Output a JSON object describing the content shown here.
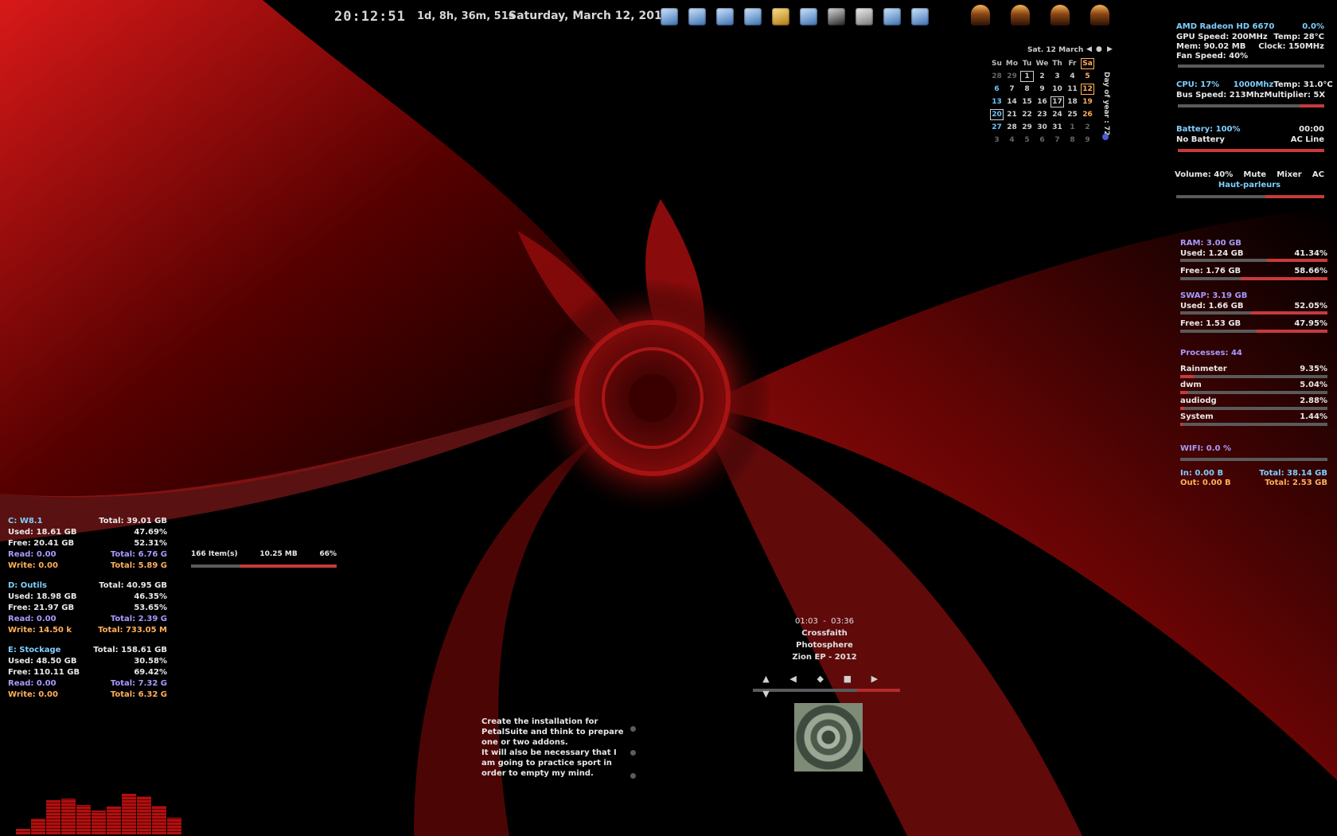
{
  "topbar": {
    "clock": "20:12:51",
    "uptime": "1d, 8h, 36m, 51s",
    "date": "Saturday, March 12, 2016",
    "dock_icons": [
      "calculator-icon",
      "paint-icon",
      "network-icon",
      "monitor-icon",
      "folder-icon",
      "task-manager-icon",
      "terminal-icon",
      "printer-icon",
      "documents-icon",
      "settings-icon"
    ],
    "lamps": [
      "lamp-1-icon",
      "lamp-2-icon",
      "lamp-3-icon",
      "lamp-4-icon"
    ]
  },
  "calendar": {
    "header": "Sat. 12 March",
    "day_names": [
      "Su",
      "Mo",
      "Tu",
      "We",
      "Th",
      "Fr",
      "Sa"
    ],
    "weeks": [
      [
        "28",
        "29",
        "1",
        "2",
        "3",
        "4",
        "5"
      ],
      [
        "6",
        "7",
        "8",
        "9",
        "10",
        "11",
        "12"
      ],
      [
        "13",
        "14",
        "15",
        "16",
        "17",
        "18",
        "19"
      ],
      [
        "20",
        "21",
        "22",
        "23",
        "24",
        "25",
        "26"
      ],
      [
        "27",
        "28",
        "29",
        "30",
        "31",
        "1",
        "2"
      ],
      [
        "3",
        "4",
        "5",
        "6",
        "7",
        "8",
        "9"
      ]
    ],
    "day_of_year": "Day of year : 72"
  },
  "gpu": {
    "name": "AMD Radeon HD 6670",
    "load": "0.0%",
    "speed": "GPU Speed: 200MHz",
    "temp": "Temp: 28°C",
    "mem": "Mem: 90.02 MB",
    "clock": "Clock: 150MHz",
    "fan": "Fan Speed: 40%",
    "bar": 0.0
  },
  "cpu": {
    "usage": "CPU: 17%",
    "freq": "1000Mhz",
    "temp": "Temp: 31.0°C",
    "bus": "Bus Speed: 213Mhz",
    "mult": "Multiplier: 5X",
    "bar": 0.17
  },
  "battery": {
    "level": "Battery: 100%",
    "time": "00:00",
    "status": "No Battery",
    "source": "AC Line",
    "bar": 1.0
  },
  "volume": {
    "level": "Volume: 40%",
    "mute": "Mute",
    "mixer": "Mixer",
    "ac": "AC",
    "device": "Haut-parleurs",
    "bar": 0.4
  },
  "ram": {
    "title": "RAM: 3.00 GB",
    "used": "Used: 1.24 GB",
    "used_pct": "41.34%",
    "free": "Free: 1.76 GB",
    "free_pct": "58.66%",
    "used_bar": 0.4134,
    "free_bar": 0.5866
  },
  "swap": {
    "title": "SWAP: 3.19 GB",
    "used": "Used: 1.66 GB",
    "used_pct": "52.05%",
    "free": "Free: 1.53 GB",
    "free_pct": "47.95%",
    "used_bar": 0.5205,
    "free_bar": 0.4795
  },
  "processes": {
    "title": "Processes: 44",
    "items": [
      {
        "name": "Rainmeter",
        "pct": "9.35%",
        "bar": 0.0935
      },
      {
        "name": "dwm",
        "pct": "5.04%",
        "bar": 0.0504
      },
      {
        "name": "audiodg",
        "pct": "2.88%",
        "bar": 0.0288
      },
      {
        "name": "System",
        "pct": "1.44%",
        "bar": 0.0144
      }
    ]
  },
  "wifi": {
    "title": "WIFI: 0.0 %",
    "in": "In: 0.00 B",
    "in_total": "Total: 38.14 GB",
    "out": "Out: 0.00 B",
    "out_total": "Total: 2.53 GB",
    "bar": 0.0
  },
  "drives": [
    {
      "name": "C: W8.1",
      "total": "Total: 39.01 GB",
      "used": "Used: 18.61 GB",
      "used_pct": "47.69%",
      "free": "Free: 20.41 GB",
      "free_pct": "52.31%",
      "read": "Read: 0.00",
      "read_total": "Total: 6.76 G",
      "write": "Write: 0.00",
      "write_total": "Total: 5.89 G"
    },
    {
      "name": "D: Outils",
      "total": "Total: 40.95 GB",
      "used": "Used: 18.98 GB",
      "used_pct": "46.35%",
      "free": "Free: 21.97 GB",
      "free_pct": "53.65%",
      "read": "Read: 0.00",
      "read_total": "Total: 2.39 G",
      "write": "Write: 14.50 k",
      "write_total": "Total: 733.05 M"
    },
    {
      "name": "E: Stockage",
      "total": "Total: 158.61 GB",
      "used": "Used: 48.50 GB",
      "used_pct": "30.58%",
      "free": "Free: 110.11 GB",
      "free_pct": "69.42%",
      "read": "Read: 0.00",
      "read_total": "Total: 7.32 G",
      "write": "Write: 0.00",
      "write_total": "Total: 6.32 G"
    }
  ],
  "recycle": {
    "items": "166 Item(s)",
    "size": "10.25 MB",
    "pct": "66%",
    "bar": 0.66
  },
  "player": {
    "position": "01:03",
    "sep": "-",
    "duration": "03:36",
    "artist": "Crossfaith",
    "track": "Photosphere",
    "album": "Zion EP - 2012",
    "controls": [
      "▲",
      "◀",
      "◆",
      "■",
      "▶",
      "▼"
    ],
    "progress": 0.29
  },
  "notes": {
    "text": "Create the installation for PetalSuite and think to prepare one or two addons.\nIt will also be necessary that I am going to practice sport in order to empty my mind."
  },
  "visualizer": {
    "levels": [
      0.12,
      0.35,
      0.74,
      0.78,
      0.64,
      0.52,
      0.6,
      0.88,
      0.82,
      0.62,
      0.36
    ]
  }
}
